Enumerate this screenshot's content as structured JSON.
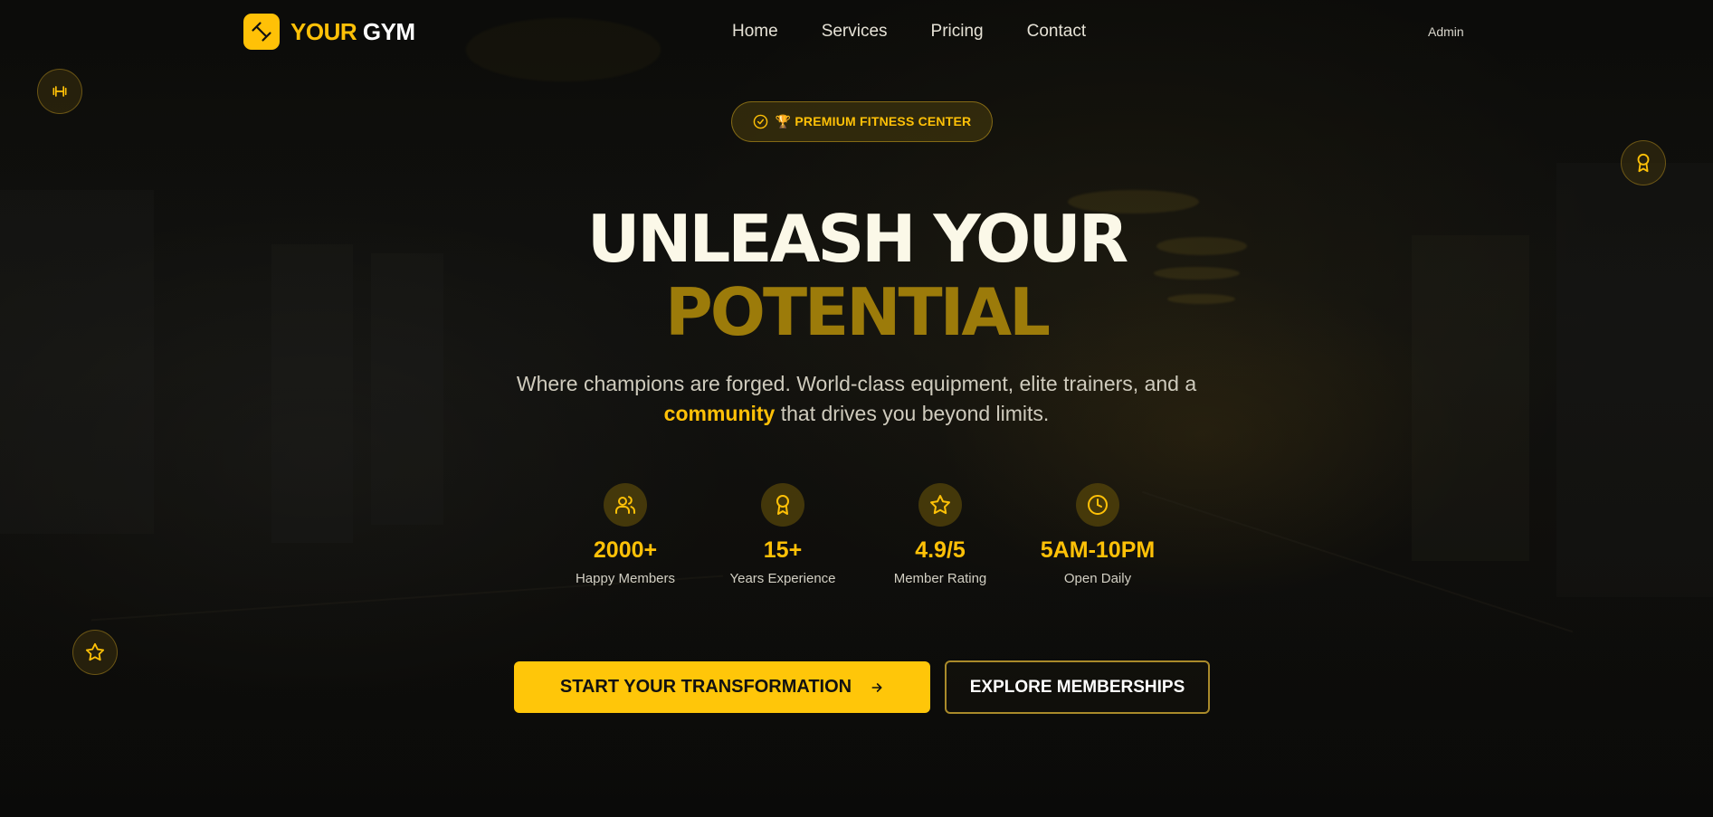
{
  "brand": {
    "name_part1": "YOUR",
    "name_part2": "GYM",
    "logo_icon": "dumbbell-icon",
    "accent": "#ffc107"
  },
  "nav": {
    "links": [
      "Home",
      "Services",
      "Pricing",
      "Contact"
    ],
    "admin_label": "Admin"
  },
  "badge": {
    "icon": "check-circle-icon",
    "text": "🏆 PREMIUM FITNESS CENTER"
  },
  "hero": {
    "title_line1": "UNLEASH YOUR",
    "title_line2": "POTENTIAL",
    "subtitle_part1": "Where champions are forged. World-class equipment, elite trainers, and a",
    "subtitle_highlight": "community",
    "subtitle_part2": "that drives you beyond limits."
  },
  "stats": [
    {
      "icon": "users-icon",
      "value": "2000+",
      "label": "Happy Members"
    },
    {
      "icon": "award-icon",
      "value": "15+",
      "label": "Years Experience"
    },
    {
      "icon": "star-icon",
      "value": "4.9/5",
      "label": "Member Rating"
    },
    {
      "icon": "clock-icon",
      "value": "5AM-10PM",
      "label": "Open Daily"
    }
  ],
  "cta": {
    "primary_label": "START YOUR TRANSFORMATION",
    "primary_icon": "arrow-right-icon",
    "secondary_label": "EXPLORE MEMBERSHIPS"
  },
  "floating": {
    "left_top_icon": "dumbbell-icon",
    "right_icon": "award-icon",
    "left_bottom_icon": "star-icon"
  }
}
